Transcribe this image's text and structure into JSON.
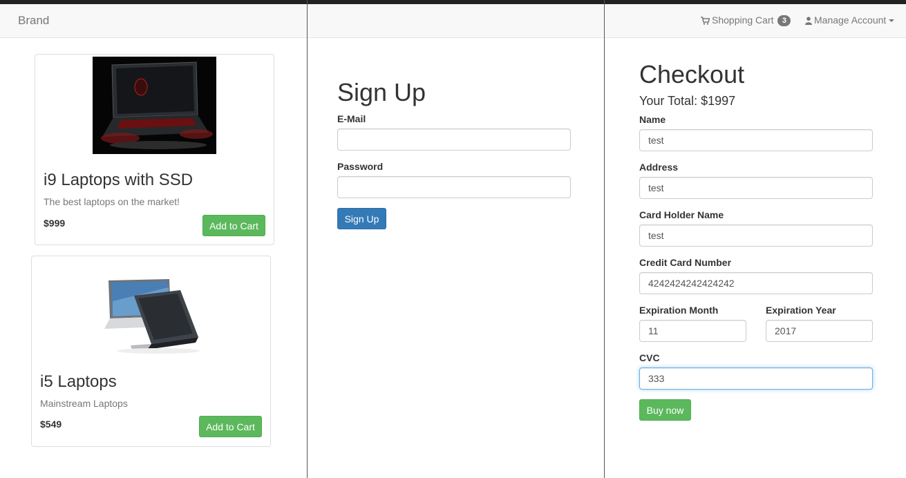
{
  "navbar": {
    "brand": "Brand",
    "cart_label": "Shopping Cart",
    "cart_count": "3",
    "account_label": "Manage Account"
  },
  "products": [
    {
      "title": "i9 Laptops with SSD",
      "description": "The best laptops on the market!",
      "price": "$999",
      "button": "Add to Cart",
      "image": "gaming-laptop-image"
    },
    {
      "title": "i5 Laptops",
      "description": "Mainstream Laptops",
      "price": "$549",
      "button": "Add to Cart",
      "image": "laptops-pair-image"
    }
  ],
  "signup": {
    "title": "Sign Up",
    "email_label": "E-Mail",
    "email_value": "",
    "password_label": "Password",
    "password_value": "",
    "button": "Sign Up"
  },
  "checkout": {
    "title": "Checkout",
    "total": "Your Total: $1997",
    "name_label": "Name",
    "name_value": "test",
    "address_label": "Address",
    "address_value": "test",
    "card_holder_label": "Card Holder Name",
    "card_holder_value": "test",
    "card_number_label": "Credit Card Number",
    "card_number_value": "4242424242424242",
    "exp_month_label": "Expiration Month",
    "exp_month_value": "11",
    "exp_year_label": "Expiration Year",
    "exp_year_value": "2017",
    "cvc_label": "CVC",
    "cvc_value": "333",
    "button": "Buy now"
  },
  "colors": {
    "success": "#5cb85c",
    "primary": "#337ab7",
    "navbar_bg": "#f8f8f8",
    "focus": "#66afe9"
  }
}
